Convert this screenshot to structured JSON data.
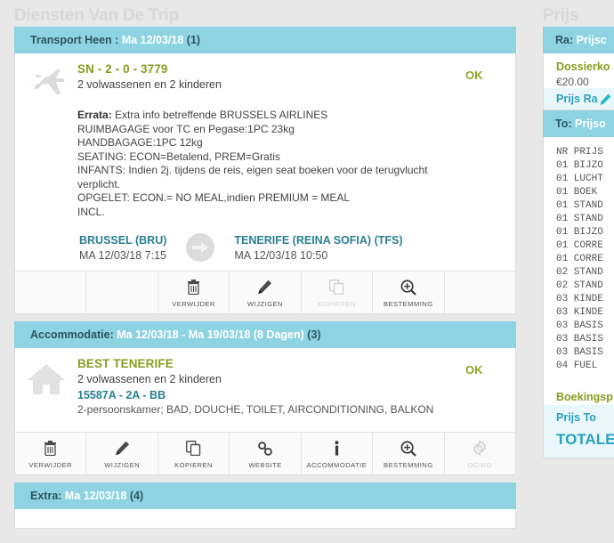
{
  "left_panel": {
    "title": "Diensten Van De Trip"
  },
  "right_panel": {
    "title": "Prijs",
    "head_ra": {
      "prefix": "Ra:",
      "rest": "Prijsc"
    },
    "dossier": {
      "label": "Dossierko",
      "value": "€20.00"
    },
    "prijs_ra": "Prijs Ra",
    "head_to": {
      "prefix": "To:",
      "rest": "Prijso"
    },
    "table_header": "NR PRIJS",
    "table_rows": [
      "01 BIJZO",
      "01 LUCHT",
      "01 BOEK",
      "01 STAND",
      "01 STAND",
      "01 BIJZO",
      "01 CORRE",
      "01 CORRE",
      "02 STAND",
      "02 STAND",
      "03 KINDE",
      "03 KINDE",
      "03 BASIS",
      "03 BASIS",
      "03 BASIS",
      "04 FUEL"
    ],
    "boekings": "Boekingsp",
    "prijs_to": "Prijs To",
    "totale": "TOTALE"
  },
  "sections": [
    {
      "name": "transport-heen",
      "head_label": "Transport Heen :",
      "head_date": "Ma 12/03/18",
      "head_count": "(1)",
      "icon": "airplane-icon",
      "status": "OK",
      "title": "SN - 2 - 0 - 3779",
      "subtitle": "2 volwassenen en 2 kinderen",
      "errata_label": "Errata:",
      "errata_lines": [
        "Extra info betreffende BRUSSELS AIRLINES",
        "RUIMBAGAGE voor TC en Pegase:1PC 23kg",
        "HANDBAGAGE:1PC 12kg",
        "SEATING: ECON=Betalend, PREM=Gratis",
        "INFANTS: Indien 2j. tijdens de reis, eigen seat boeken voor de terugvlucht",
        "verplicht.",
        "OPGELET: ECON.= NO MEAL,indien PREMIUM = MEAL",
        "INCL."
      ],
      "route": {
        "from_name": "BRUSSEL (BRU)",
        "from_when": "MA 12/03/18 7:15",
        "arrow_icon": "arrow-right-icon",
        "to_name": "TENERIFE (REINA SOFIA) (TFS)",
        "to_when": "MA 12/03/18 10:50"
      },
      "toolbar": [
        {
          "label": "",
          "icon": "",
          "empty": true,
          "disabled": false
        },
        {
          "label": "",
          "icon": "",
          "empty": true,
          "disabled": false
        },
        {
          "label": "VERWIJDER",
          "icon": "trash-icon",
          "empty": false,
          "disabled": false
        },
        {
          "label": "WIJZIGEN",
          "icon": "pencil-icon",
          "empty": false,
          "disabled": false
        },
        {
          "label": "KOPIEREN",
          "icon": "copy-icon",
          "empty": false,
          "disabled": true
        },
        {
          "label": "BESTEMMING",
          "icon": "magnifier-plus-icon",
          "empty": false,
          "disabled": false
        },
        {
          "label": "",
          "icon": "",
          "empty": true,
          "disabled": false
        }
      ]
    },
    {
      "name": "accommodatie",
      "head_label": "Accommodatie:",
      "head_date": "Ma 12/03/18 - Ma 19/03/18 (8 Dagen)",
      "head_count": "(3)",
      "icon": "house-icon",
      "status": "OK",
      "title": "BEST TENERIFE",
      "subtitle": "2 volwassenen en 2 kinderen",
      "code": "15587A - 2A - BB",
      "description": "2-persoonskamer; BAD, DOUCHE, TOILET, AIRCONDITIONING, BALKON",
      "toolbar": [
        {
          "label": "VERWIJDER",
          "icon": "trash-icon",
          "empty": false,
          "disabled": false
        },
        {
          "label": "WIJZIGEN",
          "icon": "pencil-icon",
          "empty": false,
          "disabled": false
        },
        {
          "label": "KOPIEREN",
          "icon": "copy-icon",
          "empty": false,
          "disabled": false
        },
        {
          "label": "WEBSITE",
          "icon": "link-icon",
          "empty": false,
          "disabled": false
        },
        {
          "label": "ACCOMMODATIE",
          "icon": "info-icon",
          "empty": false,
          "disabled": false
        },
        {
          "label": "BESTEMMING",
          "icon": "magnifier-plus-icon",
          "empty": false,
          "disabled": false
        },
        {
          "label": "OCIRO",
          "icon": "gear-icon",
          "empty": false,
          "disabled": true
        }
      ]
    },
    {
      "name": "extra",
      "head_label": "Extra:",
      "head_date": "Ma 12/03/18",
      "head_count": "(4)"
    }
  ],
  "colors": {
    "section_header_bg": "#8ed3e2",
    "section_header_text": "#2c5661",
    "accent_olive": "#8a9c1f",
    "accent_teal": "#2a7f93",
    "accent_cyan": "#2a9fc0",
    "page_bg": "#e8e8e8"
  }
}
